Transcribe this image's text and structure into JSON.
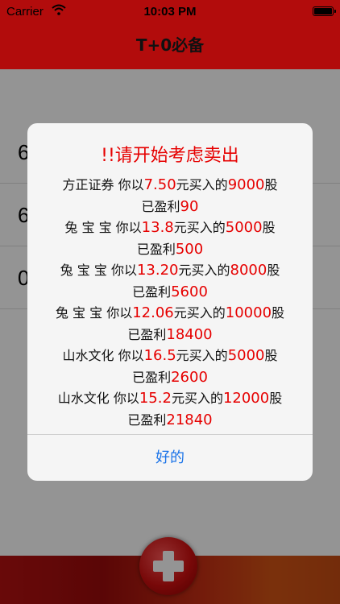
{
  "status_bar": {
    "carrier": "Carrier",
    "time": "10:03 PM"
  },
  "nav": {
    "title": "T+0必备"
  },
  "list_rows": [
    "6",
    "6",
    "0"
  ],
  "alert": {
    "title": "!!请开始考虑卖出",
    "entries": [
      {
        "name": "方正证券",
        "price": "7.50",
        "shares": "9000",
        "profit": "90"
      },
      {
        "name": "兔 宝 宝",
        "price": "13.8",
        "shares": "5000",
        "profit": "500"
      },
      {
        "name": "兔 宝 宝",
        "price": "13.20",
        "shares": "8000",
        "profit": "5600"
      },
      {
        "name": "兔 宝 宝",
        "price": "12.06",
        "shares": "10000",
        "profit": "18400"
      },
      {
        "name": "山水文化",
        "price": "16.5",
        "shares": "5000",
        "profit": "2600"
      },
      {
        "name": "山水文化",
        "price": "15.2",
        "shares": "12000",
        "profit": "21840"
      }
    ],
    "text": {
      "you_buy_at": " 你以",
      "yuan_buy": "元买入的",
      "shares_unit": "股",
      "already_profit": "已盈利"
    },
    "ok_label": "好的"
  },
  "colors": {
    "brand_red": "#b20c0c",
    "highlight_red": "#e60000",
    "link_blue": "#1a73e8"
  },
  "icons": {
    "wifi": "wifi-icon",
    "battery": "battery-icon",
    "fab": "plus-icon"
  }
}
